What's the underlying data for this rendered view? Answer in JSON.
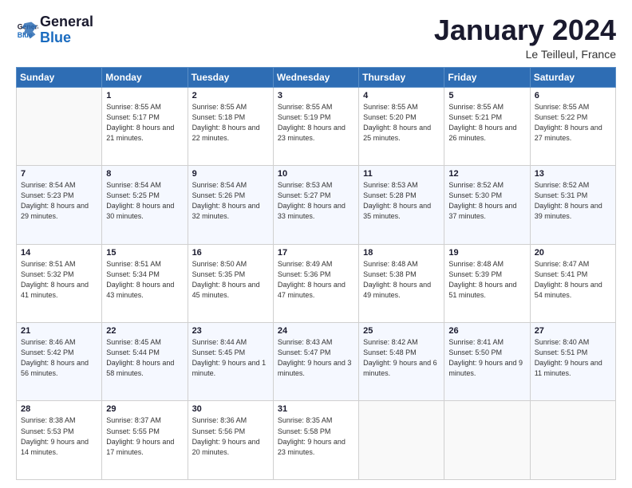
{
  "logo": {
    "text_general": "General",
    "text_blue": "Blue"
  },
  "header": {
    "month": "January 2024",
    "location": "Le Teilleul, France"
  },
  "weekdays": [
    "Sunday",
    "Monday",
    "Tuesday",
    "Wednesday",
    "Thursday",
    "Friday",
    "Saturday"
  ],
  "weeks": [
    [
      {
        "day": "",
        "sunrise": "",
        "sunset": "",
        "daylight": "",
        "empty": true
      },
      {
        "day": "1",
        "sunrise": "Sunrise: 8:55 AM",
        "sunset": "Sunset: 5:17 PM",
        "daylight": "Daylight: 8 hours and 21 minutes."
      },
      {
        "day": "2",
        "sunrise": "Sunrise: 8:55 AM",
        "sunset": "Sunset: 5:18 PM",
        "daylight": "Daylight: 8 hours and 22 minutes."
      },
      {
        "day": "3",
        "sunrise": "Sunrise: 8:55 AM",
        "sunset": "Sunset: 5:19 PM",
        "daylight": "Daylight: 8 hours and 23 minutes."
      },
      {
        "day": "4",
        "sunrise": "Sunrise: 8:55 AM",
        "sunset": "Sunset: 5:20 PM",
        "daylight": "Daylight: 8 hours and 25 minutes."
      },
      {
        "day": "5",
        "sunrise": "Sunrise: 8:55 AM",
        "sunset": "Sunset: 5:21 PM",
        "daylight": "Daylight: 8 hours and 26 minutes."
      },
      {
        "day": "6",
        "sunrise": "Sunrise: 8:55 AM",
        "sunset": "Sunset: 5:22 PM",
        "daylight": "Daylight: 8 hours and 27 minutes."
      }
    ],
    [
      {
        "day": "7",
        "sunrise": "Sunrise: 8:54 AM",
        "sunset": "Sunset: 5:23 PM",
        "daylight": "Daylight: 8 hours and 29 minutes."
      },
      {
        "day": "8",
        "sunrise": "Sunrise: 8:54 AM",
        "sunset": "Sunset: 5:25 PM",
        "daylight": "Daylight: 8 hours and 30 minutes."
      },
      {
        "day": "9",
        "sunrise": "Sunrise: 8:54 AM",
        "sunset": "Sunset: 5:26 PM",
        "daylight": "Daylight: 8 hours and 32 minutes."
      },
      {
        "day": "10",
        "sunrise": "Sunrise: 8:53 AM",
        "sunset": "Sunset: 5:27 PM",
        "daylight": "Daylight: 8 hours and 33 minutes."
      },
      {
        "day": "11",
        "sunrise": "Sunrise: 8:53 AM",
        "sunset": "Sunset: 5:28 PM",
        "daylight": "Daylight: 8 hours and 35 minutes."
      },
      {
        "day": "12",
        "sunrise": "Sunrise: 8:52 AM",
        "sunset": "Sunset: 5:30 PM",
        "daylight": "Daylight: 8 hours and 37 minutes."
      },
      {
        "day": "13",
        "sunrise": "Sunrise: 8:52 AM",
        "sunset": "Sunset: 5:31 PM",
        "daylight": "Daylight: 8 hours and 39 minutes."
      }
    ],
    [
      {
        "day": "14",
        "sunrise": "Sunrise: 8:51 AM",
        "sunset": "Sunset: 5:32 PM",
        "daylight": "Daylight: 8 hours and 41 minutes."
      },
      {
        "day": "15",
        "sunrise": "Sunrise: 8:51 AM",
        "sunset": "Sunset: 5:34 PM",
        "daylight": "Daylight: 8 hours and 43 minutes."
      },
      {
        "day": "16",
        "sunrise": "Sunrise: 8:50 AM",
        "sunset": "Sunset: 5:35 PM",
        "daylight": "Daylight: 8 hours and 45 minutes."
      },
      {
        "day": "17",
        "sunrise": "Sunrise: 8:49 AM",
        "sunset": "Sunset: 5:36 PM",
        "daylight": "Daylight: 8 hours and 47 minutes."
      },
      {
        "day": "18",
        "sunrise": "Sunrise: 8:48 AM",
        "sunset": "Sunset: 5:38 PM",
        "daylight": "Daylight: 8 hours and 49 minutes."
      },
      {
        "day": "19",
        "sunrise": "Sunrise: 8:48 AM",
        "sunset": "Sunset: 5:39 PM",
        "daylight": "Daylight: 8 hours and 51 minutes."
      },
      {
        "day": "20",
        "sunrise": "Sunrise: 8:47 AM",
        "sunset": "Sunset: 5:41 PM",
        "daylight": "Daylight: 8 hours and 54 minutes."
      }
    ],
    [
      {
        "day": "21",
        "sunrise": "Sunrise: 8:46 AM",
        "sunset": "Sunset: 5:42 PM",
        "daylight": "Daylight: 8 hours and 56 minutes."
      },
      {
        "day": "22",
        "sunrise": "Sunrise: 8:45 AM",
        "sunset": "Sunset: 5:44 PM",
        "daylight": "Daylight: 8 hours and 58 minutes."
      },
      {
        "day": "23",
        "sunrise": "Sunrise: 8:44 AM",
        "sunset": "Sunset: 5:45 PM",
        "daylight": "Daylight: 9 hours and 1 minute."
      },
      {
        "day": "24",
        "sunrise": "Sunrise: 8:43 AM",
        "sunset": "Sunset: 5:47 PM",
        "daylight": "Daylight: 9 hours and 3 minutes."
      },
      {
        "day": "25",
        "sunrise": "Sunrise: 8:42 AM",
        "sunset": "Sunset: 5:48 PM",
        "daylight": "Daylight: 9 hours and 6 minutes."
      },
      {
        "day": "26",
        "sunrise": "Sunrise: 8:41 AM",
        "sunset": "Sunset: 5:50 PM",
        "daylight": "Daylight: 9 hours and 9 minutes."
      },
      {
        "day": "27",
        "sunrise": "Sunrise: 8:40 AM",
        "sunset": "Sunset: 5:51 PM",
        "daylight": "Daylight: 9 hours and 11 minutes."
      }
    ],
    [
      {
        "day": "28",
        "sunrise": "Sunrise: 8:38 AM",
        "sunset": "Sunset: 5:53 PM",
        "daylight": "Daylight: 9 hours and 14 minutes."
      },
      {
        "day": "29",
        "sunrise": "Sunrise: 8:37 AM",
        "sunset": "Sunset: 5:55 PM",
        "daylight": "Daylight: 9 hours and 17 minutes."
      },
      {
        "day": "30",
        "sunrise": "Sunrise: 8:36 AM",
        "sunset": "Sunset: 5:56 PM",
        "daylight": "Daylight: 9 hours and 20 minutes."
      },
      {
        "day": "31",
        "sunrise": "Sunrise: 8:35 AM",
        "sunset": "Sunset: 5:58 PM",
        "daylight": "Daylight: 9 hours and 23 minutes."
      },
      {
        "day": "",
        "sunrise": "",
        "sunset": "",
        "daylight": "",
        "empty": true
      },
      {
        "day": "",
        "sunrise": "",
        "sunset": "",
        "daylight": "",
        "empty": true
      },
      {
        "day": "",
        "sunrise": "",
        "sunset": "",
        "daylight": "",
        "empty": true
      }
    ]
  ]
}
